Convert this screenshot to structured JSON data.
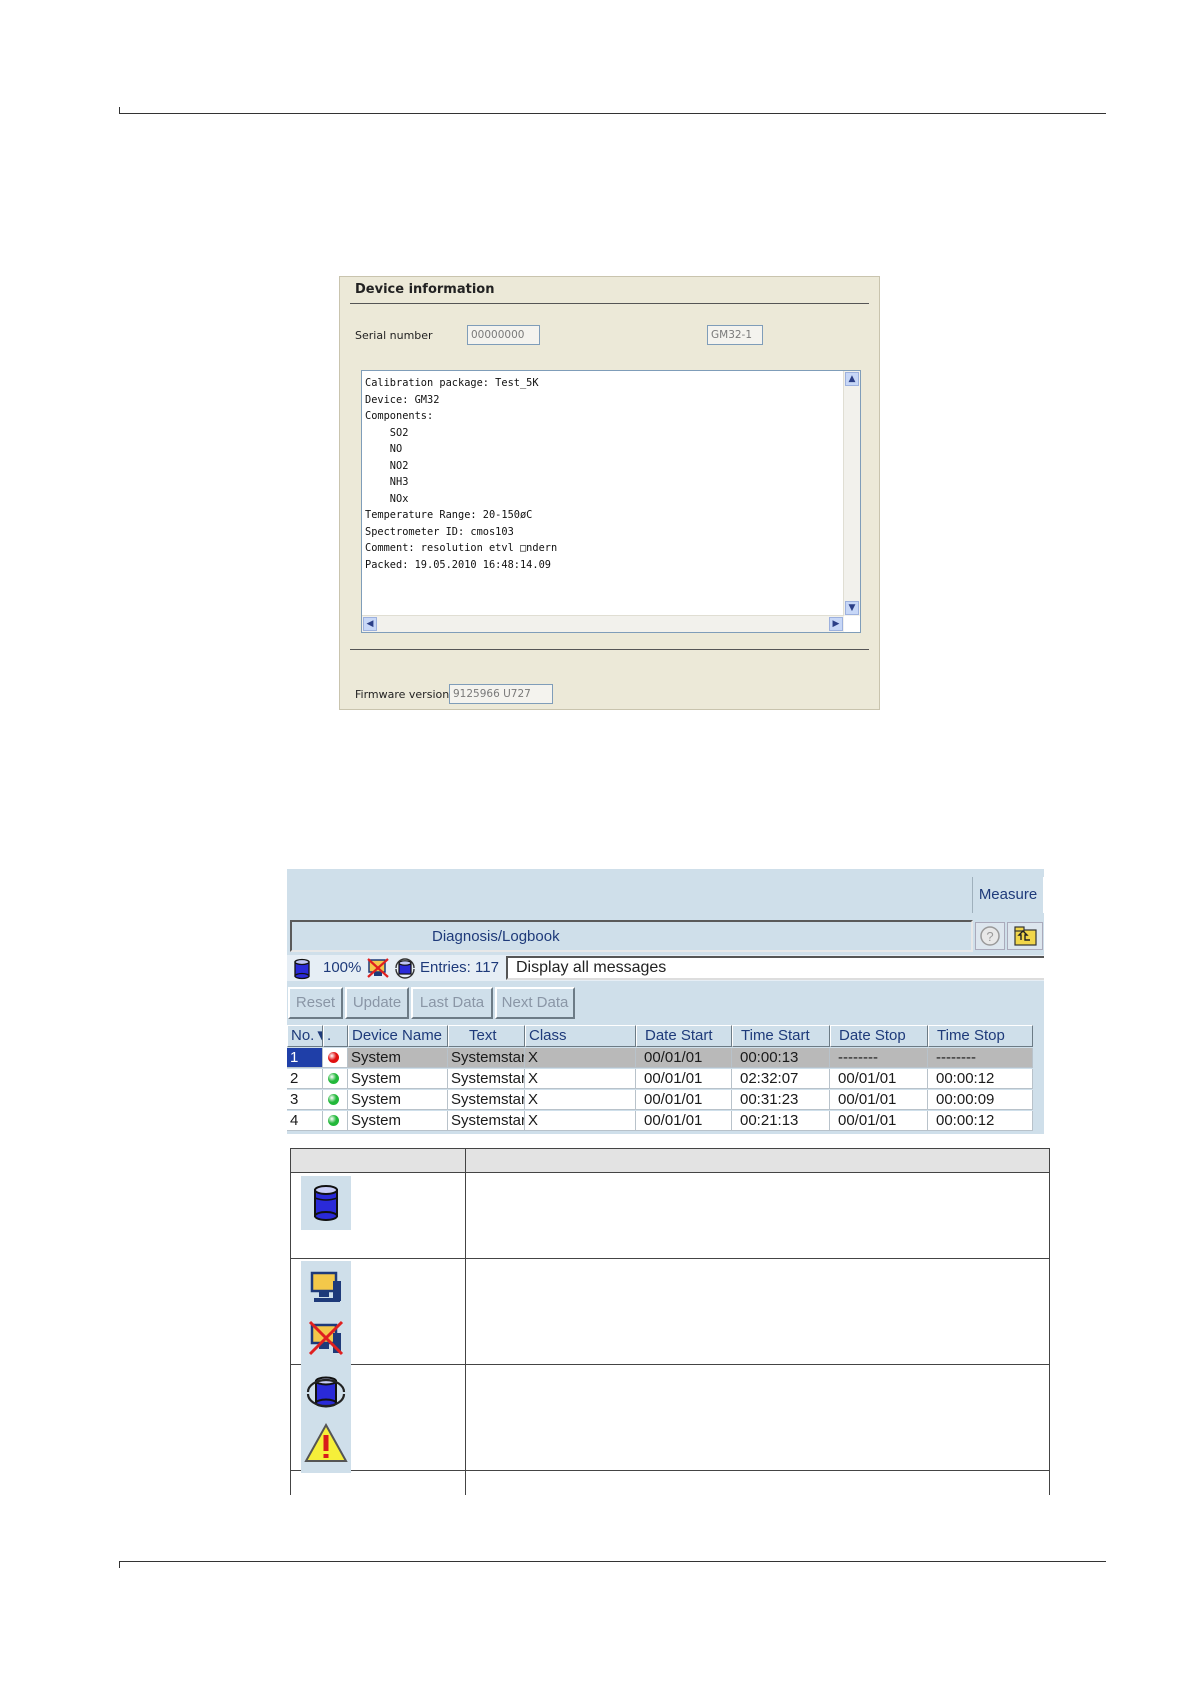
{
  "device_info": {
    "title": "Device information",
    "serial_label": "Serial number",
    "serial_value": "00000000",
    "device_value": "GM32-1",
    "text_lines": [
      "Calibration package: Test_5K",
      "Device: GM32",
      "Components:",
      "    SO2",
      "    NO",
      "    NO2",
      "    NH3",
      "    NOx",
      "Temperature Range: 20-150øC",
      "Spectrometer ID: cmos103",
      "Comment: resolution etvl □ndern",
      "Packed: 19.05.2010 16:48:14.09"
    ],
    "firmware_label": "Firmware version",
    "firmware_value": "9125966 U727"
  },
  "logbook": {
    "measure_tab": "Measure",
    "menu_title": "Diagnosis/Logbook",
    "status": {
      "percent": "100%",
      "entries": "Entries: 117",
      "filter": "Display all messages"
    },
    "buttons": [
      "Reset",
      "Update",
      "Last Data",
      "Next Data"
    ],
    "columns": [
      "No.▼",
      ".",
      "Device Name",
      "Text",
      "Class",
      "Date Start",
      "Time Start",
      "Date Stop",
      "Time Stop"
    ],
    "rows": [
      {
        "no": "1",
        "status": "red",
        "device": "System",
        "text": "Systemstart",
        "class": "X",
        "date_start": "00/01/01",
        "time_start": "00:00:13",
        "date_stop": "--------",
        "time_stop": "--------"
      },
      {
        "no": "2",
        "status": "green",
        "device": "System",
        "text": "Systemstart",
        "class": "X",
        "date_start": "00/01/01",
        "time_start": "02:32:07",
        "date_stop": "00/01/01",
        "time_stop": "00:00:12"
      },
      {
        "no": "3",
        "status": "green",
        "device": "System",
        "text": "Systemstart",
        "class": "X",
        "date_start": "00/01/01",
        "time_start": "00:31:23",
        "date_stop": "00/01/01",
        "time_stop": "00:00:09"
      },
      {
        "no": "4",
        "status": "green",
        "device": "System",
        "text": "Systemstart",
        "class": "X",
        "date_start": "00/01/01",
        "time_start": "00:21:13",
        "date_stop": "00/01/01",
        "time_stop": "00:00:12"
      }
    ],
    "status_colors": {
      "red": "#e01010",
      "green": "#22b83a"
    }
  },
  "symbol_table": {
    "icons": [
      "database-icon",
      "monitor-connected-icon",
      "monitor-disconnected-icon",
      "database-sync-icon",
      "warning-icon"
    ]
  }
}
